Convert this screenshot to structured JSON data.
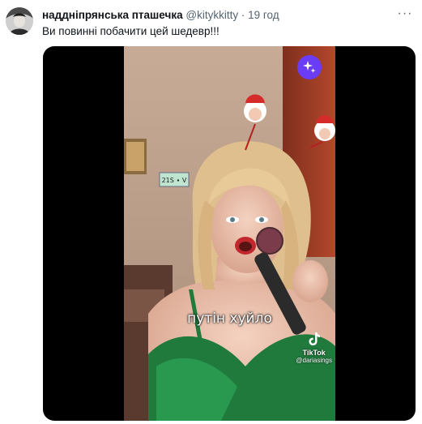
{
  "tweet": {
    "author_name": "наддніпрянська пташечка",
    "author_handle": "@kitykkitty",
    "separator": "·",
    "time": "19 год",
    "text": "Ви повинні побачити цей шедевр!!!",
    "more_label": "···"
  },
  "video": {
    "subtitle": "путін хуйло",
    "watermark_brand": "TikTok",
    "watermark_user": "@dariasings"
  },
  "icons": {
    "more": "more-horizontal-icon",
    "sparkle": "sparkle-icon",
    "tiktok": "tiktok-logo-icon"
  },
  "colors": {
    "text": "#0f1419",
    "secondary": "#536471",
    "sparkle_button": "#6b3cf5",
    "dress": "#1f7a3c"
  }
}
